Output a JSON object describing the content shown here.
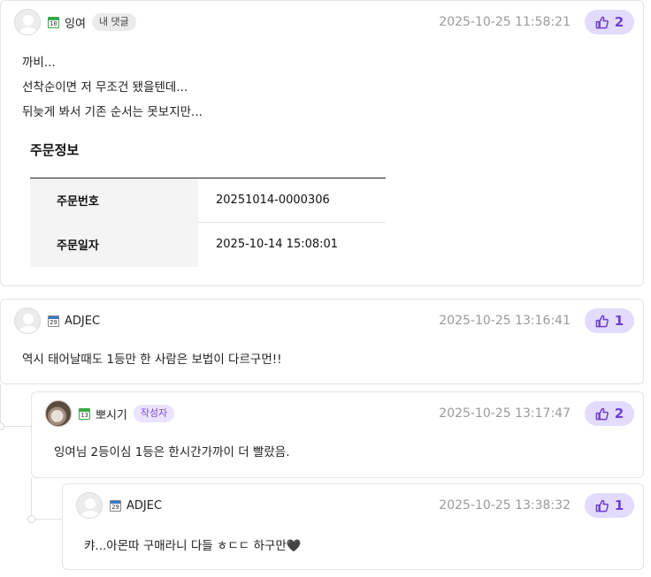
{
  "comments": [
    {
      "level": "10",
      "nickname": "잉여",
      "tag": "내 댓글",
      "timestamp": "2025-10-25 11:58:21",
      "likes": "2",
      "lines": [
        "까비...",
        "선착순이면 저 무조건 됐을텐데...",
        "뒤늦게 봐서 기존 순서는 못보지만..."
      ],
      "order_info": {
        "title": "주문정보",
        "rows": [
          {
            "label": "주문번호",
            "value": "20251014-0000306"
          },
          {
            "label": "주문일자",
            "value": "2025-10-14 15:08:01"
          }
        ]
      }
    },
    {
      "level": "29",
      "nickname": "ADJEC",
      "timestamp": "2025-10-25 13:16:41",
      "likes": "1",
      "lines": [
        "역시 태어날때도 1등만 한 사람은 보법이 다르구먼!!"
      ]
    },
    {
      "level": "13",
      "nickname": "뽀시기",
      "tag": "작성자",
      "timestamp": "2025-10-25 13:17:47",
      "likes": "2",
      "lines": [
        "잉여님 2등이심 1등은 한시간가까이 더 빨랐음."
      ]
    },
    {
      "level": "29",
      "nickname": "ADJEC",
      "timestamp": "2025-10-25 13:38:32",
      "likes": "1",
      "lines": [
        "캬...아몬따 구매라니 다들 ㅎㄷㄷ 하구만🖤"
      ]
    }
  ],
  "icons": {
    "avatar": "default-user-icon",
    "like": "thumbs-up-icon"
  },
  "colors": {
    "accent": "#6b3fd1",
    "like_bg": "#e3dbfc",
    "writer_tag_bg": "#ebe3ff"
  }
}
